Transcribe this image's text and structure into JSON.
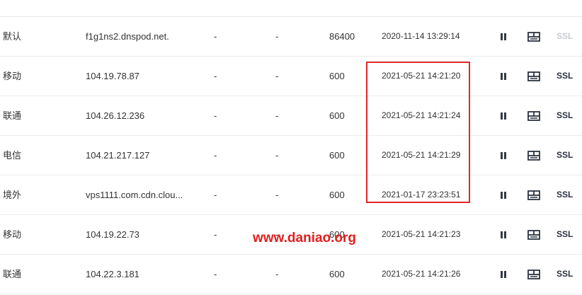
{
  "records": [
    {
      "line": "默认",
      "value": "f1g1ns2.dnspod.net.",
      "mx": "-",
      "weight": "-",
      "ttl": "86400",
      "time": "2020-11-14 13:29:14",
      "ssl": "SSL"
    },
    {
      "line": "移动",
      "value": "104.19.78.87",
      "mx": "-",
      "weight": "-",
      "ttl": "600",
      "time": "2021-05-21 14:21:20",
      "ssl": "SSL"
    },
    {
      "line": "联通",
      "value": "104.26.12.236",
      "mx": "-",
      "weight": "-",
      "ttl": "600",
      "time": "2021-05-21 14:21:24",
      "ssl": "SSL"
    },
    {
      "line": "电信",
      "value": "104.21.217.127",
      "mx": "-",
      "weight": "-",
      "ttl": "600",
      "time": "2021-05-21 14:21:29",
      "ssl": "SSL"
    },
    {
      "line": "境外",
      "value": "vps1111.com.cdn.clou...",
      "mx": "-",
      "weight": "-",
      "ttl": "600",
      "time": "2021-01-17 23:23:51",
      "ssl": "SSL"
    },
    {
      "line": "移动",
      "value": "104.19.22.73",
      "mx": "-",
      "weight": "-",
      "ttl": "600",
      "time": "2021-05-21 14:21:23",
      "ssl": "SSL"
    },
    {
      "line": "联通",
      "value": "104.22.3.181",
      "mx": "-",
      "weight": "-",
      "ttl": "600",
      "time": "2021-05-21 14:21:26",
      "ssl": "SSL"
    }
  ],
  "watermark": "www.daniao.org",
  "colors": {
    "highlight_border": "#e02626",
    "watermark": "#e01f1f",
    "ssl_active": "#2b3340",
    "ssl_disabled": "#c6ccd4"
  },
  "icons": {
    "pause": "pause-icon",
    "remark": "remark-icon"
  }
}
